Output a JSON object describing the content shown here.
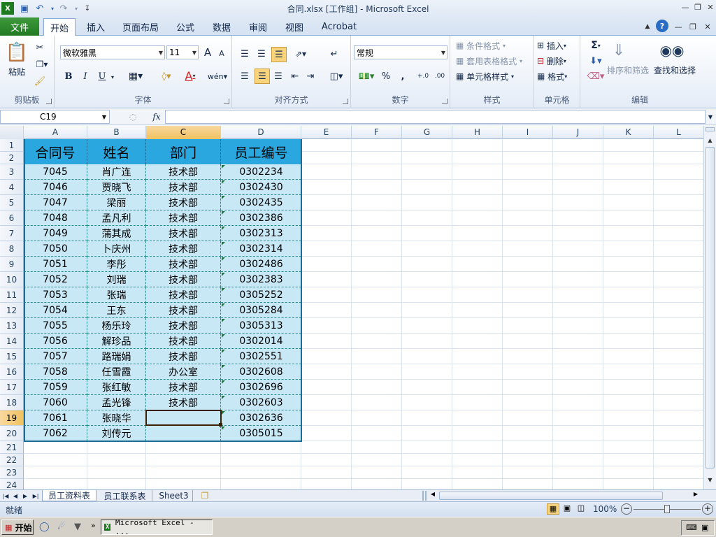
{
  "window": {
    "title": "合同.xlsx  [工作组]  -  Microsoft Excel"
  },
  "ribbon_tabs": {
    "file": "文件",
    "tabs": [
      "开始",
      "插入",
      "页面布局",
      "公式",
      "数据",
      "审阅",
      "视图",
      "Acrobat"
    ]
  },
  "ribbon": {
    "clipboard": {
      "paste": "粘贴",
      "label": "剪贴板"
    },
    "font": {
      "name": "微软雅黑",
      "size": "11",
      "bold": "B",
      "italic": "I",
      "underline": "U",
      "grow": "A",
      "shrink": "A",
      "label": "字体"
    },
    "alignment": {
      "label": "对齐方式"
    },
    "number": {
      "format": "常规",
      "percent": "%",
      "comma": ",",
      "label": "数字"
    },
    "styles": {
      "conditional": "条件格式",
      "table": "套用表格格式",
      "cell_styles": "单元格样式",
      "label": "样式"
    },
    "cells": {
      "insert": "插入",
      "delete": "删除",
      "format": "格式",
      "label": "单元格"
    },
    "editing": {
      "sigma": "Σ",
      "sort": "排序和筛选",
      "find": "查找和选择",
      "label": "编辑"
    }
  },
  "formula_bar": {
    "name_box": "C19",
    "fx": "fx",
    "value": ""
  },
  "grid": {
    "columns": [
      "A",
      "B",
      "C",
      "D",
      "E",
      "F",
      "G",
      "H",
      "I",
      "J",
      "K",
      "L"
    ],
    "selected_column": "C",
    "selected_row": 19,
    "header": [
      "合同号",
      "姓名",
      "部门",
      "员工编号"
    ],
    "rows": [
      [
        "7045",
        "肖广连",
        "技术部",
        "0302234"
      ],
      [
        "7046",
        "贾晓飞",
        "技术部",
        "0302430"
      ],
      [
        "7047",
        "梁丽",
        "技术部",
        "0302435"
      ],
      [
        "7048",
        "孟凡利",
        "技术部",
        "0302386"
      ],
      [
        "7049",
        "蒲其成",
        "技术部",
        "0302313"
      ],
      [
        "7050",
        "卜庆州",
        "技术部",
        "0302314"
      ],
      [
        "7051",
        "李彤",
        "技术部",
        "0302486"
      ],
      [
        "7052",
        "刘瑞",
        "技术部",
        "0302383"
      ],
      [
        "7053",
        "张瑞",
        "技术部",
        "0305252"
      ],
      [
        "7054",
        "王东",
        "技术部",
        "0305284"
      ],
      [
        "7055",
        "杨乐玲",
        "技术部",
        "0305313"
      ],
      [
        "7056",
        "解珍品",
        "技术部",
        "0302014"
      ],
      [
        "7057",
        "路瑞娟",
        "技术部",
        "0302551"
      ],
      [
        "7058",
        "任雪霞",
        "办公室",
        "0302608"
      ],
      [
        "7059",
        "张红敏",
        "技术部",
        "0302696"
      ],
      [
        "7060",
        "孟光锋",
        "技术部",
        "0302603"
      ],
      [
        "7061",
        "张晓华",
        "",
        "0302636"
      ],
      [
        "7062",
        "刘传元",
        "",
        "0305015"
      ]
    ],
    "row_numbers": [
      "1",
      "2",
      "3",
      "4",
      "5",
      "6",
      "7",
      "8",
      "9",
      "10",
      "11",
      "12",
      "13",
      "14",
      "15",
      "16",
      "17",
      "18",
      "19",
      "20",
      "21",
      "22",
      "23",
      "24"
    ]
  },
  "sheets": {
    "tabs": [
      "员工资料表",
      "员工联系表",
      "Sheet3"
    ],
    "active": 0
  },
  "status_bar": {
    "ready": "就绪",
    "zoom": "100%"
  },
  "taskbar": {
    "start": "开始",
    "task": "Microsoft Excel - ..."
  }
}
